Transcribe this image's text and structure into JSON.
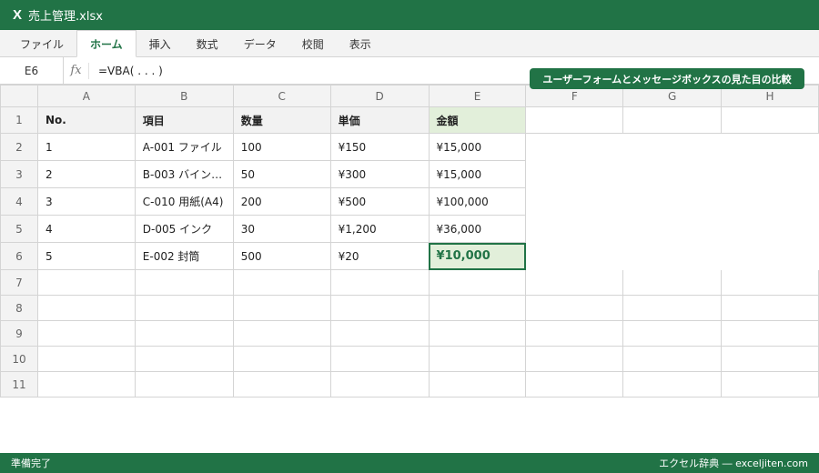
{
  "titlebar": {
    "app_icon": "X",
    "filename": "売上管理.xlsx"
  },
  "ribbon": {
    "tabs": [
      "ファイル",
      "ホーム",
      "挿入",
      "数式",
      "データ",
      "校閲",
      "表示"
    ],
    "active_tab": "ホーム"
  },
  "formula_bar": {
    "name_box": "E6",
    "fx_label": "fx",
    "formula": "=VBA( . . . )"
  },
  "callout": {
    "text": "ユーザーフォームとメッセージボックスの見た目の比較"
  },
  "columns": [
    "A",
    "B",
    "C",
    "D",
    "E",
    "F",
    "G",
    "H"
  ],
  "header_row": {
    "row": "1",
    "cells": [
      "No.",
      "項目",
      "数量",
      "単価",
      "金額"
    ]
  },
  "data_rows": [
    {
      "row": "2",
      "cells": [
        "1",
        "A-001 ファイル",
        "100",
        "¥150",
        "¥15,000"
      ]
    },
    {
      "row": "3",
      "cells": [
        "2",
        "B-003 バイン…",
        "50",
        "¥300",
        "¥15,000"
      ]
    },
    {
      "row": "4",
      "cells": [
        "3",
        "C-010 用紙(A4)",
        "200",
        "¥500",
        "¥100,000"
      ]
    },
    {
      "row": "5",
      "cells": [
        "4",
        "D-005 インク",
        "30",
        "¥1,200",
        "¥36,000"
      ]
    },
    {
      "row": "6",
      "cells": [
        "5",
        "E-002 封筒",
        "500",
        "¥20",
        "¥10,000"
      ]
    }
  ],
  "empty_rows": [
    "7",
    "8",
    "9",
    "10",
    "11"
  ],
  "active_cell": "E6",
  "statusbar": {
    "left": "準備完了",
    "right": "エクセル辞典 ― exceljiten.com"
  },
  "colors": {
    "accent": "#217346",
    "selected_fill": "#e2efda",
    "gridline": "#d4d4d4"
  }
}
